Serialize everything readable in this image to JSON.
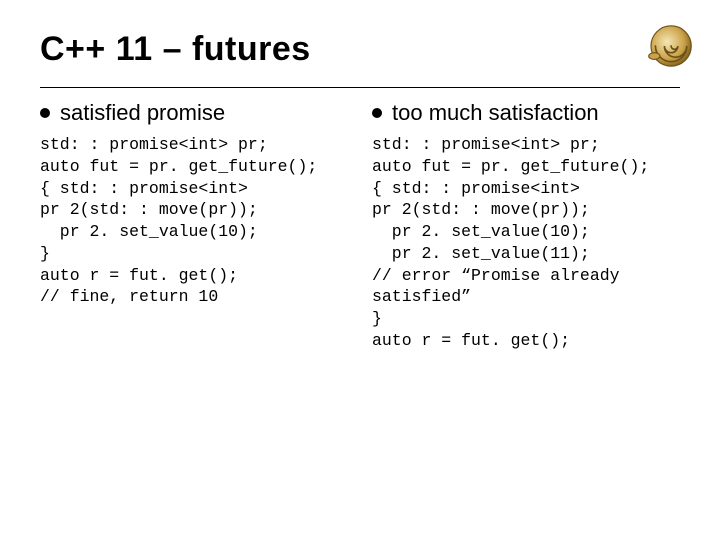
{
  "title": "C++ 11 – futures",
  "icon_name": "shell-icon",
  "columns": [
    {
      "subhead": "satisfied promise",
      "code": "std: : promise<int> pr;\nauto fut = pr. get_future();\n{ std: : promise<int>\npr 2(std: : move(pr));\n  pr 2. set_value(10);\n}\nauto r = fut. get();\n// fine, return 10"
    },
    {
      "subhead": "too much satisfaction",
      "code": "std: : promise<int> pr;\nauto fut = pr. get_future();\n{ std: : promise<int>\npr 2(std: : move(pr));\n  pr 2. set_value(10);\n  pr 2. set_value(11);\n// error “Promise already\nsatisfied”\n}\nauto r = fut. get();"
    }
  ]
}
